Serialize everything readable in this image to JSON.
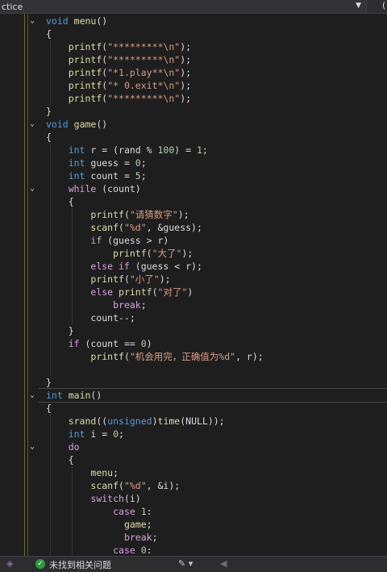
{
  "toolbar": {
    "scope_text": "ctice",
    "scope_dropdown_icon": "dropdown-arrow-icon",
    "right_text": "("
  },
  "code": [
    [
      [
        "k",
        "void"
      ],
      [
        "p",
        " "
      ],
      [
        "f",
        "menu"
      ],
      [
        "p",
        "()"
      ]
    ],
    [
      [
        "p",
        "{"
      ]
    ],
    [
      [
        "p",
        "    "
      ],
      [
        "f",
        "printf"
      ],
      [
        "p",
        "("
      ],
      [
        "s",
        "\"*********\\n\""
      ],
      [
        "p",
        ");"
      ]
    ],
    [
      [
        "p",
        "    "
      ],
      [
        "f",
        "printf"
      ],
      [
        "p",
        "("
      ],
      [
        "s",
        "\"*********\\n\""
      ],
      [
        "p",
        ");"
      ]
    ],
    [
      [
        "p",
        "    "
      ],
      [
        "f",
        "printf"
      ],
      [
        "p",
        "("
      ],
      [
        "s",
        "\"*1.play**\\n\""
      ],
      [
        "p",
        ");"
      ]
    ],
    [
      [
        "p",
        "    "
      ],
      [
        "f",
        "printf"
      ],
      [
        "p",
        "("
      ],
      [
        "s",
        "\"* 0.exit*\\n\""
      ],
      [
        "p",
        ");"
      ]
    ],
    [
      [
        "p",
        "    "
      ],
      [
        "f",
        "printf"
      ],
      [
        "p",
        "("
      ],
      [
        "s",
        "\"*********\\n\""
      ],
      [
        "p",
        ");"
      ]
    ],
    [
      [
        "p",
        "}"
      ]
    ],
    [
      [
        "k",
        "void"
      ],
      [
        "p",
        " "
      ],
      [
        "f",
        "game"
      ],
      [
        "p",
        "()"
      ]
    ],
    [
      [
        "p",
        "{"
      ]
    ],
    [
      [
        "p",
        "    "
      ],
      [
        "k",
        "int"
      ],
      [
        "p",
        " r = (rand % "
      ],
      [
        "n",
        "100"
      ],
      [
        "p",
        ") = "
      ],
      [
        "n",
        "1"
      ],
      [
        "p",
        ";"
      ]
    ],
    [
      [
        "p",
        "    "
      ],
      [
        "k",
        "int"
      ],
      [
        "p",
        " guess = "
      ],
      [
        "n",
        "0"
      ],
      [
        "p",
        ";"
      ]
    ],
    [
      [
        "p",
        "    "
      ],
      [
        "k",
        "int"
      ],
      [
        "p",
        " count = "
      ],
      [
        "n",
        "5"
      ],
      [
        "p",
        ";"
      ]
    ],
    [
      [
        "p",
        "    "
      ],
      [
        "c",
        "while"
      ],
      [
        "p",
        " (count)"
      ]
    ],
    [
      [
        "p",
        "    {"
      ]
    ],
    [
      [
        "p",
        "        "
      ],
      [
        "f",
        "printf"
      ],
      [
        "p",
        "("
      ],
      [
        "s",
        "\"请猜数字\""
      ],
      [
        "p",
        ");"
      ]
    ],
    [
      [
        "p",
        "        "
      ],
      [
        "f",
        "scanf"
      ],
      [
        "p",
        "("
      ],
      [
        "s",
        "\"%d\""
      ],
      [
        "p",
        ", &guess);"
      ]
    ],
    [
      [
        "p",
        "        "
      ],
      [
        "c",
        "if"
      ],
      [
        "p",
        " (guess > r)"
      ]
    ],
    [
      [
        "p",
        "            "
      ],
      [
        "f",
        "printf"
      ],
      [
        "p",
        "("
      ],
      [
        "s",
        "\"大了\""
      ],
      [
        "p",
        ");"
      ]
    ],
    [
      [
        "p",
        "        "
      ],
      [
        "c",
        "else if"
      ],
      [
        "p",
        " (guess < r);"
      ]
    ],
    [
      [
        "p",
        "        "
      ],
      [
        "f",
        "printf"
      ],
      [
        "p",
        "("
      ],
      [
        "s",
        "\"小了\""
      ],
      [
        "p",
        ");"
      ]
    ],
    [
      [
        "p",
        "        "
      ],
      [
        "c",
        "else"
      ],
      [
        "p",
        " "
      ],
      [
        "f",
        "printf"
      ],
      [
        "p",
        "("
      ],
      [
        "s",
        "\"对了\""
      ],
      [
        "p",
        ")"
      ]
    ],
    [
      [
        "p",
        "            "
      ],
      [
        "c",
        "break"
      ],
      [
        "p",
        ";"
      ]
    ],
    [
      [
        "p",
        "        count--;"
      ]
    ],
    [
      [
        "p",
        "    }"
      ]
    ],
    [
      [
        "p",
        "    "
      ],
      [
        "c",
        "if"
      ],
      [
        "p",
        " (count == "
      ],
      [
        "n",
        "0"
      ],
      [
        "p",
        ")"
      ]
    ],
    [
      [
        "p",
        "        "
      ],
      [
        "f",
        "printf"
      ],
      [
        "p",
        "("
      ],
      [
        "s",
        "\"机会用完，正确值为%d\""
      ],
      [
        "p",
        ", r);"
      ]
    ],
    [
      [
        "p",
        ""
      ]
    ],
    [
      [
        "p",
        "}"
      ]
    ],
    [
      [
        "k",
        "int"
      ],
      [
        "p",
        " "
      ],
      [
        "f",
        "main"
      ],
      [
        "p",
        "()"
      ]
    ],
    [
      [
        "p",
        "{"
      ]
    ],
    [
      [
        "p",
        "    "
      ],
      [
        "f",
        "srand"
      ],
      [
        "p",
        "(("
      ],
      [
        "k",
        "unsigned"
      ],
      [
        "p",
        ")"
      ],
      [
        "f",
        "time"
      ],
      [
        "p",
        "(NULL));"
      ]
    ],
    [
      [
        "p",
        "    "
      ],
      [
        "k",
        "int"
      ],
      [
        "p",
        " i = "
      ],
      [
        "n",
        "0"
      ],
      [
        "p",
        ";"
      ]
    ],
    [
      [
        "p",
        "    "
      ],
      [
        "c",
        "do"
      ]
    ],
    [
      [
        "p",
        "    {"
      ]
    ],
    [
      [
        "p",
        "        "
      ],
      [
        "f",
        "menu"
      ],
      [
        "p",
        ";"
      ]
    ],
    [
      [
        "p",
        "        "
      ],
      [
        "f",
        "scanf"
      ],
      [
        "p",
        "("
      ],
      [
        "s",
        "\"%d\""
      ],
      [
        "p",
        ", &i);"
      ]
    ],
    [
      [
        "p",
        "        "
      ],
      [
        "c",
        "switch"
      ],
      [
        "p",
        "(i)"
      ]
    ],
    [
      [
        "p",
        "            "
      ],
      [
        "c",
        "case"
      ],
      [
        "p",
        " "
      ],
      [
        "n",
        "1"
      ],
      [
        "p",
        ":"
      ]
    ],
    [
      [
        "p",
        "              "
      ],
      [
        "f",
        "game"
      ],
      [
        "p",
        ";"
      ]
    ],
    [
      [
        "p",
        "              "
      ],
      [
        "c",
        "break"
      ],
      [
        "p",
        ";"
      ]
    ],
    [
      [
        "p",
        "            "
      ],
      [
        "c",
        "case"
      ],
      [
        "p",
        " "
      ],
      [
        "n",
        "0"
      ],
      [
        "p",
        ":"
      ]
    ]
  ],
  "fold_icons": [
    "fold-collapse-icon"
  ],
  "statusbar": {
    "ok_icon": "check-circle-icon",
    "message": "未找到相关问题",
    "tools_icon": "brush-icon",
    "nav_icon": "arrow-left-icon"
  },
  "colors": {
    "background": "#1e1e1e",
    "keyword": "#569cd6",
    "control_keyword": "#d8a0df",
    "string": "#d69d85",
    "function": "#dcdcaa",
    "number": "#b5cea8",
    "text": "#dcdcdc"
  }
}
